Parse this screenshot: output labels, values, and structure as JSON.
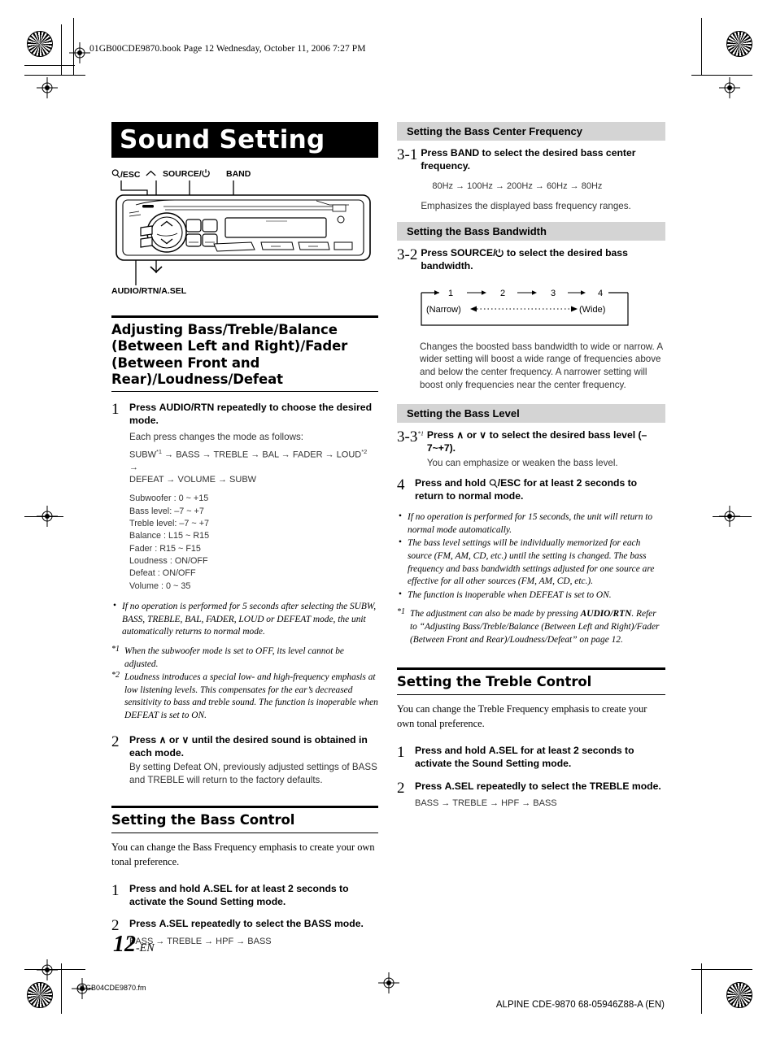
{
  "header": {
    "book_line": "01GB00CDE9870.book  Page 12  Wednesday, October 11, 2006  7:27 PM"
  },
  "chapter": {
    "title": "Sound Setting"
  },
  "figure": {
    "labels": {
      "esc": "/ESC",
      "source": "SOURCE/",
      "band": "BAND",
      "audio": "AUDIO/RTN/A.SEL"
    },
    "icon_names": [
      "magnifier-icon",
      "up-chevron-icon",
      "power-icon",
      "down-chevron-icon"
    ]
  },
  "left": {
    "section1": {
      "heading": "Adjusting Bass/Treble/Balance (Between Left and Right)/Fader (Between Front and Rear)/Loudness/Defeat",
      "step1": {
        "num": "1",
        "title_pre": "Press ",
        "title_bold": "AUDIO/RTN",
        "title_post": " repeatedly to choose the desired mode.",
        "note": "Each press changes the mode as follows:",
        "flow_line1": "SUBW*1 → BASS → TREBLE → BAL → FADER → LOUD*2 →",
        "flow_line2": "DEFEAT → VOLUME → SUBW",
        "params": [
          "Subwoofer : 0 ~ +15",
          "Bass level: –7 ~ +7",
          "Treble level: –7 ~ +7",
          "Balance : L15 ~ R15",
          "Fader : R15 ~ F15",
          "Loudness : ON/OFF",
          "Defeat : ON/OFF",
          "Volume : 0 ~ 35"
        ]
      },
      "bullets": [
        "If no operation is performed for 5 seconds after selecting the SUBW, BASS, TREBLE, BAL, FADER, LOUD or DEFEAT mode, the unit automatically returns to normal mode."
      ],
      "footnotes": [
        {
          "mark": "*1",
          "text": "When the subwoofer mode is set to OFF, its level cannot be adjusted."
        },
        {
          "mark": "*2",
          "text": "Loudness introduces a special low- and high-frequency emphasis at low listening levels. This compensates for the ear’s decreased sensitivity to bass and treble sound. The function is inoperable when DEFEAT is set to ON."
        }
      ],
      "step2": {
        "num": "2",
        "title": "Press ∧ or ∨ until the desired sound is obtained in each mode.",
        "note": "By setting Defeat ON, previously adjusted settings of BASS and TREBLE will return to the factory defaults."
      }
    },
    "section2": {
      "heading": "Setting the Bass Control",
      "intro": "You can change the Bass Frequency emphasis to create your own tonal preference.",
      "step1": {
        "num": "1",
        "title_pre": "Press and hold ",
        "title_bold": "A.SEL",
        "title_post": " for at least 2 seconds to activate the Sound Setting mode."
      },
      "step2": {
        "num": "2",
        "title_pre": "Press ",
        "title_bold": "A.SEL",
        "title_post": " repeatedly to select the BASS mode.",
        "flow": "BASS → TREBLE → HPF → BASS"
      }
    }
  },
  "right": {
    "bass_center_frequency": {
      "heading": "Setting the Bass Center Frequency",
      "step": {
        "num": "3-1",
        "title_pre": "Press ",
        "title_bold": "BAND",
        "title_post": " to select the desired bass center frequency.",
        "flow": "80Hz → 100Hz → 200Hz → 60Hz → 80Hz",
        "note": "Emphasizes the displayed bass frequency ranges."
      }
    },
    "bass_bandwidth": {
      "heading": "Setting the Bass Bandwidth",
      "step": {
        "num": "3-2",
        "title_pre": "Press ",
        "title_bold": "SOURCE/",
        "title_post": " to select the desired bass bandwidth."
      },
      "diagram": {
        "values": [
          "1",
          "2",
          "3",
          "4"
        ],
        "left_label": "(Narrow)",
        "right_label": "(Wide)"
      },
      "description": "Changes the boosted bass bandwidth to wide or narrow. A wider setting will boost a wide range of frequencies above and below the center frequency. A narrower setting will boost only frequencies near the center frequency."
    },
    "bass_level": {
      "heading": "Setting the Bass Level",
      "step3": {
        "num": "3-3",
        "mark": "*1",
        "title": "Press ∧ or ∨ to select the desired bass level (–7~+7).",
        "note": "You can emphasize or weaken the bass level."
      },
      "step4": {
        "num": "4",
        "title_pre": "Press and hold ",
        "title_mid": "/ESC",
        "title_post": " for at least 2 seconds to return to normal mode."
      },
      "bullets": [
        "If no operation is performed for 15 seconds, the unit will return to normal mode automatically.",
        "The bass level settings will be individually memorized for each source (FM, AM, CD, etc.) until the setting is changed. The bass frequency and bass bandwidth settings adjusted for one source are effective for all other sources (FM, AM, CD, etc.).",
        "The function is inoperable when DEFEAT is set to ON."
      ],
      "footnote": {
        "mark": "*1",
        "text_pre": "The adjustment can also be made by pressing ",
        "text_bold": "AUDIO/RTN",
        "text_post": ". Refer to “Adjusting Bass/Treble/Balance (Between Left and Right)/Fader (Between Front and Rear)/Loudness/Defeat” on page 12."
      }
    },
    "treble_control": {
      "heading": "Setting the Treble Control",
      "intro": "You can change the Treble Frequency emphasis to create your own tonal preference.",
      "step1": {
        "num": "1",
        "title_pre": "Press and hold ",
        "title_bold": "A.SEL",
        "title_post": " for at least 2 seconds to activate the Sound Setting mode."
      },
      "step2": {
        "num": "2",
        "title_pre": "Press ",
        "title_bold": "A.SEL",
        "title_post": " repeatedly to select the TREBLE mode.",
        "flow": "BASS → TREBLE → HPF → BASS"
      }
    }
  },
  "footer": {
    "page_number": "12",
    "page_suffix": "-EN",
    "file_name": "01GB04CDE9870.fm",
    "imprint": "ALPINE CDE-9870 68-05946Z88-A (EN)"
  }
}
